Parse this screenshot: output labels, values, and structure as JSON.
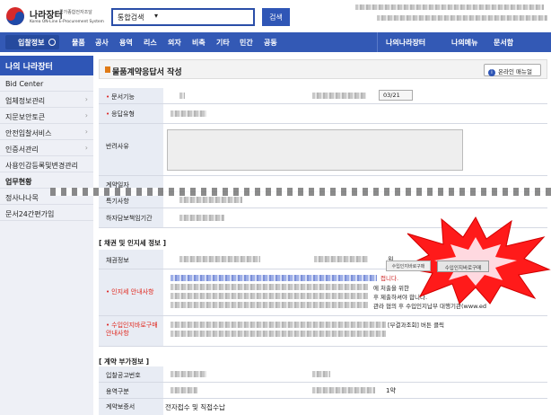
{
  "header": {
    "logo_name": "나라장터",
    "logo_sub": "국가종합전자조달",
    "logo_eng": "Korea ON-Line E-Procurement System",
    "search_select": "통합검색",
    "search_button": "검색"
  },
  "nav": {
    "home": "입찰정보",
    "items": [
      "물품",
      "공사",
      "용역",
      "리스",
      "외자",
      "비축",
      "기타",
      "민간",
      "공동"
    ],
    "right": [
      "나의나라장터",
      "나의메뉴",
      "문서함"
    ]
  },
  "sidebar": {
    "title": "나의 나라장터",
    "items": [
      {
        "label": "Bid Center",
        "arrow": false
      },
      {
        "label": "업체정보관리",
        "arrow": true
      },
      {
        "label": "지문보안토큰",
        "arrow": true
      },
      {
        "label": "안전입찰서비스",
        "arrow": true
      },
      {
        "label": "인증서관리",
        "arrow": true
      },
      {
        "label": "사용인감등록및변경관리",
        "arrow": false
      },
      {
        "label": "업무현황",
        "arrow": false
      },
      {
        "label": "정사나나목",
        "arrow": false
      },
      {
        "label": "문서24간편가입",
        "arrow": false
      }
    ]
  },
  "main": {
    "title": "물품계약응답서 작성",
    "manual_button": "온라인 매뉴얼",
    "info_icon": "i",
    "rows": {
      "doc_no": "문서기능",
      "response_type": "응답유형",
      "reason": "반려사유",
      "contract_date": "계약일자",
      "special": "특기사항",
      "warranty": "하자담보책임기간"
    },
    "date_value": "03/21",
    "section_bond": "[ 채권 및 인지세 정보 ]",
    "bond_info": "채권정보",
    "bond_suffix": "원",
    "stamp_tax": "인지세 안내사항",
    "import_stamp": "수입인지바로구매\n안내사항",
    "stamp_text_1": "접니다.",
    "stamp_text_2": "에 처출을 위한",
    "stamp_text_3": "후 제출하셔야 합니다.",
    "stamp_text_4": "관라 협의 후 수입인지납부 대행기관(www.ed",
    "result_text": "[부결과조회] 버튼 클릭",
    "export_btn": "수입인지바로구매",
    "import_btn": "수입인지바로구매",
    "section_extra": "[ 계약 부가정보 ]",
    "bid_notice_no": "입찰공고번호",
    "service_type": "용역구분",
    "contract_bond": "계약보증서",
    "contract_bond_value": "전자접수 및 직접수납",
    "suffix_1": "1약"
  }
}
